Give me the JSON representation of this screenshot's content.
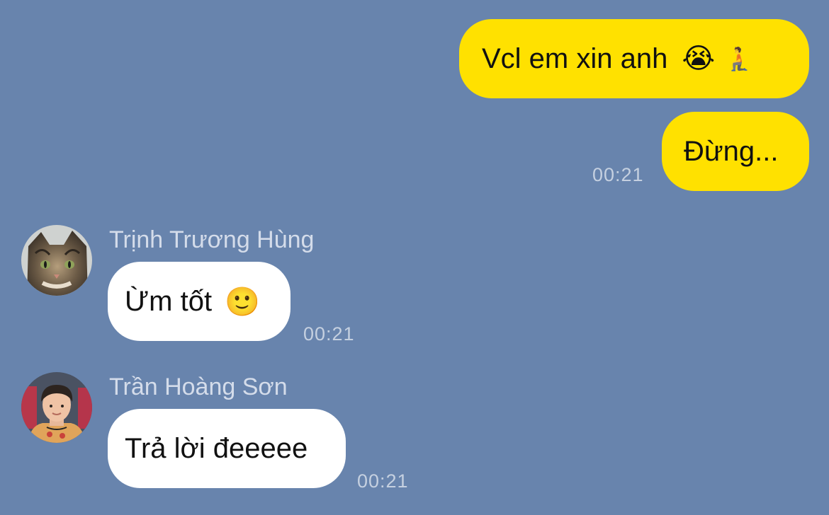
{
  "messages": {
    "out1": {
      "text": "Vcl em xin anh",
      "emoji1": "😭",
      "emoji2": "🧎"
    },
    "out2": {
      "text": "Đừng...",
      "time": "00:21"
    },
    "in1": {
      "sender": "Trịnh Trương Hùng",
      "text": "Ừm tốt",
      "emoji": "🙂",
      "time": "00:21"
    },
    "in2": {
      "sender": "Trần Hoàng Sơn",
      "text": "Trả lời đeeeee",
      "time": "00:21"
    }
  },
  "colors": {
    "background": "#6884ad",
    "outgoing_bubble": "#ffe100",
    "incoming_bubble": "#ffffff",
    "timestamp": "#c5d0e0",
    "sender_name": "#d4dcea"
  },
  "icons": {
    "avatar1": "cat-avatar",
    "avatar2": "person-avatar"
  }
}
